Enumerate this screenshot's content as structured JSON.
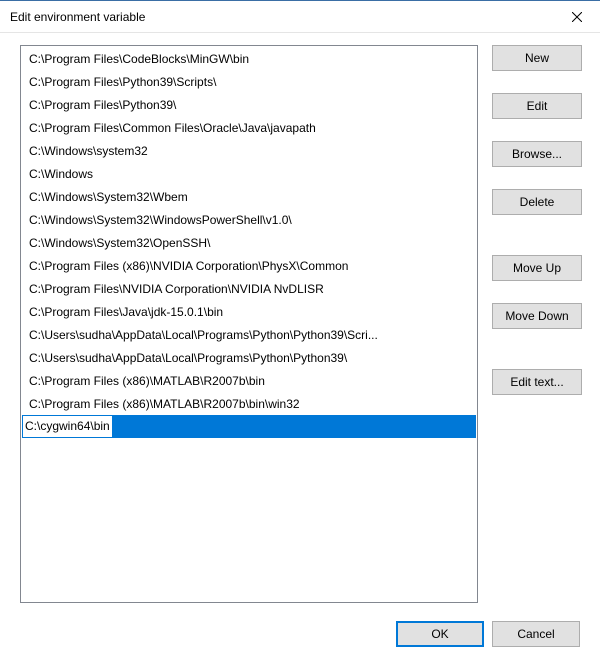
{
  "titlebar": {
    "title": "Edit environment variable"
  },
  "list": {
    "items": [
      "C:\\Program Files\\CodeBlocks\\MinGW\\bin",
      "C:\\Program Files\\Python39\\Scripts\\",
      "C:\\Program Files\\Python39\\",
      "C:\\Program Files\\Common Files\\Oracle\\Java\\javapath",
      "C:\\Windows\\system32",
      "C:\\Windows",
      "C:\\Windows\\System32\\Wbem",
      "C:\\Windows\\System32\\WindowsPowerShell\\v1.0\\",
      "C:\\Windows\\System32\\OpenSSH\\",
      "C:\\Program Files (x86)\\NVIDIA Corporation\\PhysX\\Common",
      "C:\\Program Files\\NVIDIA Corporation\\NVIDIA NvDLISR",
      "C:\\Program Files\\Java\\jdk-15.0.1\\bin",
      "C:\\Users\\sudha\\AppData\\Local\\Programs\\Python\\Python39\\Scri...",
      "C:\\Users\\sudha\\AppData\\Local\\Programs\\Python\\Python39\\",
      "C:\\Program Files (x86)\\MATLAB\\R2007b\\bin",
      "C:\\Program Files (x86)\\MATLAB\\R2007b\\bin\\win32",
      "C:\\cygwin64\\bin"
    ],
    "selected_index": 16,
    "editing": true
  },
  "buttons": {
    "new": "New",
    "edit": "Edit",
    "browse": "Browse...",
    "delete": "Delete",
    "move_up": "Move Up",
    "move_down": "Move Down",
    "edit_text": "Edit text...",
    "ok": "OK",
    "cancel": "Cancel"
  }
}
